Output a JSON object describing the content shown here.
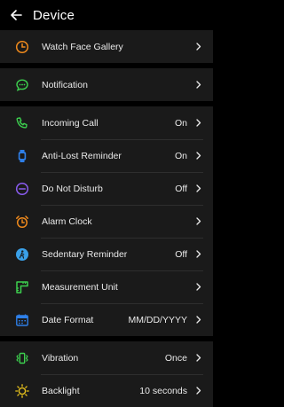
{
  "header": {
    "title": "Device",
    "back_icon": "arrow-left-icon"
  },
  "sections": [
    [
      {
        "id": "watch-face-gallery",
        "label": "Watch Face Gallery",
        "value": "",
        "icon": "watch-face-icon",
        "color": "#f08a1c"
      }
    ],
    [
      {
        "id": "notification",
        "label": "Notification",
        "value": "",
        "icon": "chat-bubble-icon",
        "color": "#3ccf4e"
      }
    ],
    [
      {
        "id": "incoming-call",
        "label": "Incoming Call",
        "value": "On",
        "icon": "phone-icon",
        "color": "#3ccf4e"
      },
      {
        "id": "anti-lost-reminder",
        "label": "Anti-Lost Reminder",
        "value": "On",
        "icon": "watch-icon",
        "color": "#2e7fe8"
      },
      {
        "id": "do-not-disturb",
        "label": "Do Not Disturb",
        "value": "Off",
        "icon": "do-not-disturb-icon",
        "color": "#8a5cf0"
      },
      {
        "id": "alarm-clock",
        "label": "Alarm Clock",
        "value": "",
        "icon": "alarm-clock-icon",
        "color": "#f08a1c"
      },
      {
        "id": "sedentary-reminder",
        "label": "Sedentary Reminder",
        "value": "Off",
        "icon": "person-icon",
        "color": "#3aa0e8"
      },
      {
        "id": "measurement-unit",
        "label": "Measurement Unit",
        "value": "",
        "icon": "ruler-icon",
        "color": "#3ccf4e"
      },
      {
        "id": "date-format",
        "label": "Date Format",
        "value": "MM/DD/YYYY",
        "icon": "calendar-icon",
        "color": "#2e7fe8"
      }
    ],
    [
      {
        "id": "vibration",
        "label": "Vibration",
        "value": "Once",
        "icon": "vibration-icon",
        "color": "#3ccf4e"
      },
      {
        "id": "backlight",
        "label": "Backlight",
        "value": "10 seconds",
        "icon": "sun-icon",
        "color": "#e8c21c"
      }
    ]
  ]
}
